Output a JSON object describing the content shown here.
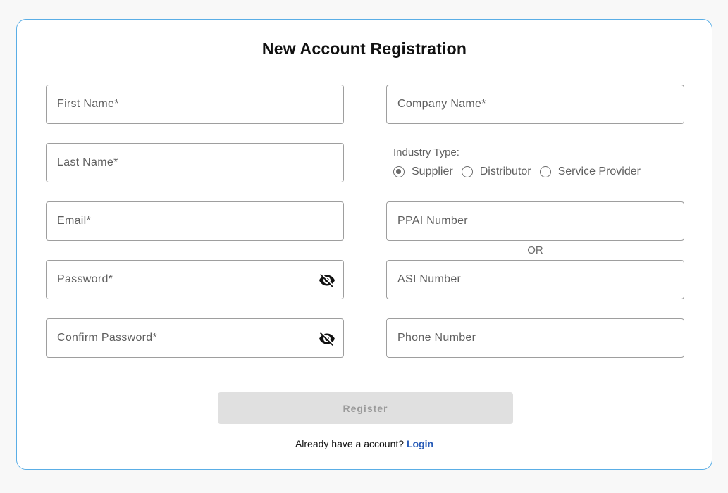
{
  "form": {
    "title": "New Account Registration",
    "fields": {
      "first_name": {
        "placeholder": "First Name*",
        "value": ""
      },
      "last_name": {
        "placeholder": "Last Name*",
        "value": ""
      },
      "email": {
        "placeholder": "Email*",
        "value": ""
      },
      "password": {
        "placeholder": "Password*",
        "value": ""
      },
      "confirm_password": {
        "placeholder": "Confirm Password*",
        "value": ""
      },
      "company_name": {
        "placeholder": "Company Name*",
        "value": ""
      },
      "ppai_number": {
        "placeholder": "PPAI Number",
        "value": ""
      },
      "asi_number": {
        "placeholder": "ASI Number",
        "value": ""
      },
      "phone_number": {
        "placeholder": "Phone Number",
        "value": ""
      }
    },
    "industry": {
      "label": "Industry Type:",
      "options": [
        {
          "label": "Supplier",
          "checked": true
        },
        {
          "label": "Distributor",
          "checked": false
        },
        {
          "label": "Service Provider",
          "checked": false
        }
      ]
    },
    "or_separator": "OR",
    "register_label": "Register",
    "login_prompt": "Already have a account?",
    "login_link": "Login"
  },
  "icons": {
    "password_toggle": "eye-off-icon",
    "confirm_password_toggle": "eye-off-icon"
  },
  "colors": {
    "card_border": "#5aaee6",
    "link": "#2a5db8",
    "button_disabled_bg": "#e0e0e0",
    "button_disabled_text": "#9a9a9a"
  }
}
